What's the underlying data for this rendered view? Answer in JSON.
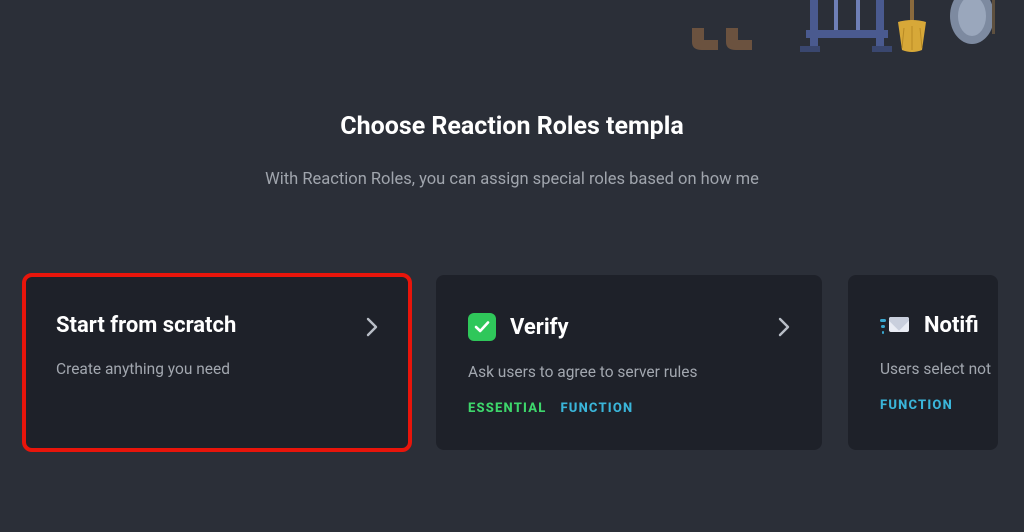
{
  "page": {
    "title": "Choose Reaction Roles templa",
    "subtitle": "With Reaction Roles, you can assign special roles based on how me"
  },
  "cards": {
    "scratch": {
      "title": "Start from scratch",
      "desc": "Create anything you need"
    },
    "verify": {
      "title": "Verify",
      "desc": "Ask users to agree to server rules",
      "tag_essential": "Essential",
      "tag_function": "Function"
    },
    "notifications": {
      "title": "Notifi",
      "desc": "Users select not",
      "tag_function": "Function"
    }
  },
  "colors": {
    "bg": "#2b2f38",
    "card": "#1e2129",
    "highlight": "#e8150b",
    "green": "#3dd66b",
    "cyan": "#3ab5d9",
    "muted": "#a2a7af"
  }
}
